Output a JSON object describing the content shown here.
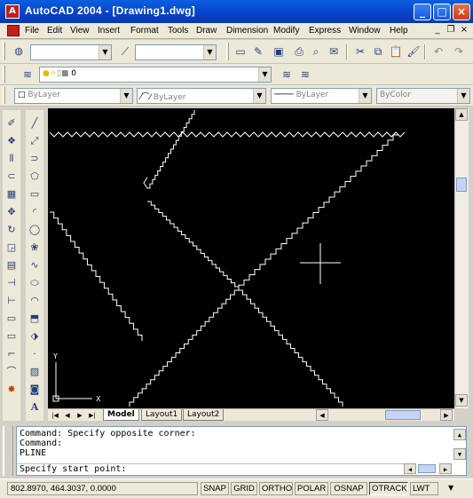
{
  "window": {
    "title": "AutoCAD 2004 - [Drawing1.dwg]",
    "app_icon": "autocad-app-icon",
    "controls": [
      "minimize",
      "maximize",
      "close"
    ]
  },
  "menubar": {
    "items": [
      "File",
      "Edit",
      "View",
      "Insert",
      "Format",
      "Tools",
      "Draw",
      "Dimension",
      "Modify",
      "Express",
      "Window",
      "Help"
    ]
  },
  "layers_toolbar": {
    "layer_value": "0"
  },
  "properties_toolbar": {
    "color": "ByLayer",
    "linetype": "ByLayer",
    "lineweight": "ByLayer",
    "plotstyle": "ByColor"
  },
  "layout_tabs": [
    "Model",
    "Layout1",
    "Layout2"
  ],
  "command_window": {
    "history": [
      "Command: Specify opposite corner:",
      "Command:",
      "PLINE"
    ],
    "prompt": "Specify start point:"
  },
  "status_bar": {
    "coordinates": "802.8970, 464.3037, 0.0000",
    "toggles": [
      {
        "label": "SNAP",
        "on": false
      },
      {
        "label": "GRID",
        "on": false
      },
      {
        "label": "ORTHO",
        "on": false
      },
      {
        "label": "POLAR",
        "on": false
      },
      {
        "label": "OSNAP",
        "on": false
      },
      {
        "label": "OTRACK",
        "on": true
      },
      {
        "label": "LWT",
        "on": false
      }
    ]
  },
  "ucs_icon": {
    "x_label": "X",
    "y_label": "Y"
  },
  "colors": {
    "canvas_bg": "#000000",
    "drawing_lines": "#ffffff",
    "titlebar": "#0a5fe0"
  }
}
